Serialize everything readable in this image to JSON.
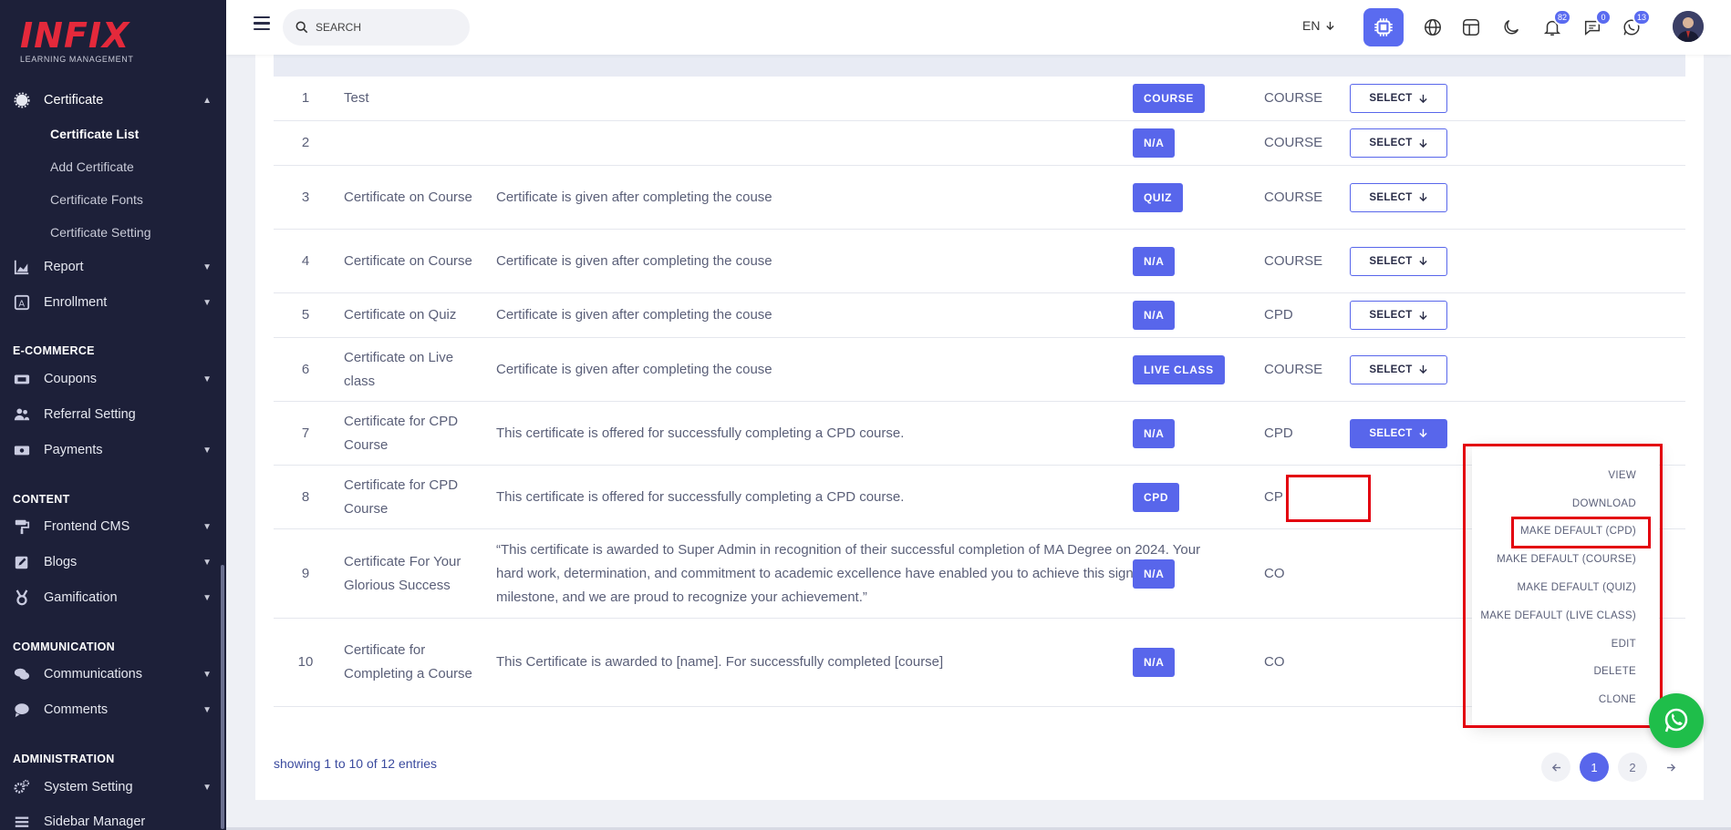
{
  "brand": {
    "logo": "INFIX",
    "tagline": "LEARNING MANAGEMENT"
  },
  "sidebar": {
    "certificate": {
      "label": "Certificate",
      "children": [
        "Certificate List",
        "Add Certificate",
        "Certificate Fonts",
        "Certificate Setting"
      ]
    },
    "report": "Report",
    "enrollment": "Enrollment",
    "section_ecommerce": "E-COMMERCE",
    "coupons": "Coupons",
    "referral": "Referral Setting",
    "payments": "Payments",
    "section_content": "CONTENT",
    "frontend": "Frontend CMS",
    "blogs": "Blogs",
    "gamification": "Gamification",
    "section_communication": "COMMUNICATION",
    "communications": "Communications",
    "comments": "Comments",
    "section_administration": "ADMINISTRATION",
    "system": "System Setting",
    "sidebar_manager": "Sidebar Manager"
  },
  "topbar": {
    "search_placeholder": "SEARCH",
    "lang": "EN",
    "badges": {
      "notifications": "82",
      "messages": "0",
      "whatsapp": "13"
    }
  },
  "table": {
    "rows": [
      {
        "sl": "1",
        "title": "Test",
        "body": "",
        "for": "COURSE",
        "type": "COURSE",
        "action": "SELECT"
      },
      {
        "sl": "2",
        "title": "",
        "body": "",
        "for": "N/A",
        "type": "COURSE",
        "action": "SELECT"
      },
      {
        "sl": "3",
        "title": "Certificate on Course",
        "body": "Certificate is given after completing the couse",
        "for": "QUIZ",
        "type": "COURSE",
        "action": "SELECT"
      },
      {
        "sl": "4",
        "title": "Certificate on Course",
        "body": "Certificate is given after completing the couse",
        "for": "N/A",
        "type": "COURSE",
        "action": "SELECT"
      },
      {
        "sl": "5",
        "title": "Certificate on Quiz",
        "body": "Certificate is given after completing the couse",
        "for": "N/A",
        "type": "CPD",
        "action": "SELECT"
      },
      {
        "sl": "6",
        "title": "Certificate on Live class",
        "body": "Certificate is given after completing the couse",
        "for": "LIVE CLASS",
        "type": "COURSE",
        "action": "SELECT"
      },
      {
        "sl": "7",
        "title": "Certificate for CPD Course",
        "body": "This certificate is offered for successfully completing a CPD course.",
        "for": "N/A",
        "type": "CPD",
        "action": "SELECT"
      },
      {
        "sl": "8",
        "title": "Certificate for CPD Course",
        "body": "This certificate is offered for successfully completing a CPD course.",
        "for": "CPD",
        "type": "CP",
        "action": ""
      },
      {
        "sl": "9",
        "title": "Certificate For Your Glorious Success",
        "body": "“This certificate is awarded to Super Admin in recognition of their successful completion of MA Degree on 2024. Your hard work, determination, and commitment to academic excellence have enabled you to achieve this significant milestone, and we are proud to recognize your achievement.”",
        "for": "N/A",
        "type": "CO",
        "action": ""
      },
      {
        "sl": "10",
        "title": "Certificate for Completing a Course",
        "body": "This Certificate is awarded to [name]. For successfully completed [course]",
        "for": "N/A",
        "type": "CO",
        "action": ""
      }
    ]
  },
  "dropdown": [
    "VIEW",
    "DOWNLOAD",
    "MAKE DEFAULT (CPD)",
    "MAKE DEFAULT (COURSE)",
    "MAKE DEFAULT (QUIZ)",
    "MAKE DEFAULT (LIVE CLASS)",
    "EDIT",
    "DELETE",
    "CLONE"
  ],
  "footer": {
    "showing": "showing 1 to 10 of 12 entries",
    "pages": [
      "1",
      "2"
    ]
  },
  "colors": {
    "accent": "#5866eb",
    "sidebar": "#1d2039",
    "highlight": "#e3000f",
    "whatsapp": "#1fbe4a"
  }
}
